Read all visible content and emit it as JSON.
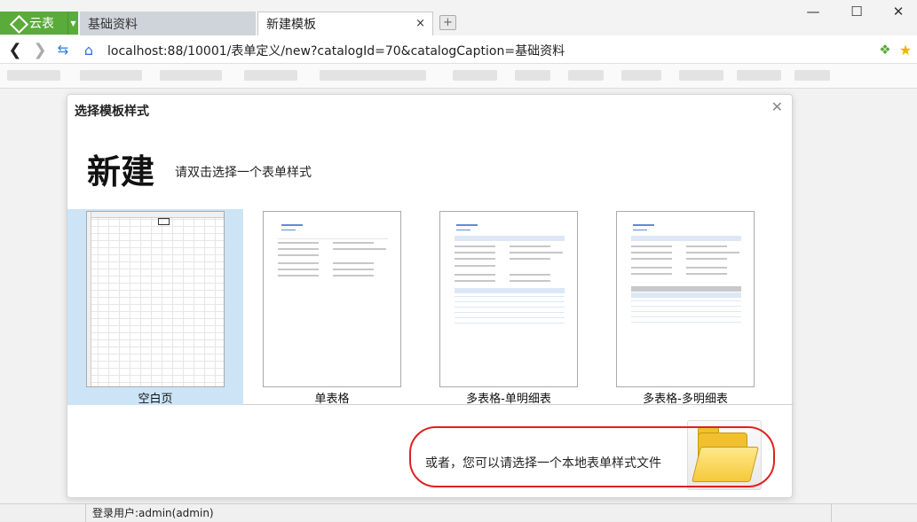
{
  "browser": {
    "app_label": "云表",
    "tabs": [
      {
        "label": "基础资料"
      },
      {
        "label": "新建模板"
      }
    ],
    "tab_close": "×",
    "new_tab": "+",
    "url": "localhost:88/10001/表单定义/new?catalogId=70&catalogCaption=基础资料"
  },
  "dialog": {
    "title": "选择模板样式",
    "big_title": "新建",
    "hint": "请双击选择一个表单样式",
    "templates": [
      {
        "label": "空白页"
      },
      {
        "label": "单表格"
      },
      {
        "label": "多表格-单明细表"
      },
      {
        "label": "多表格-多明细表"
      }
    ],
    "local_file_text": "或者，您可以请选择一个本地表单样式文件"
  },
  "statusbar": {
    "user": "登录用户:admin(admin)"
  }
}
